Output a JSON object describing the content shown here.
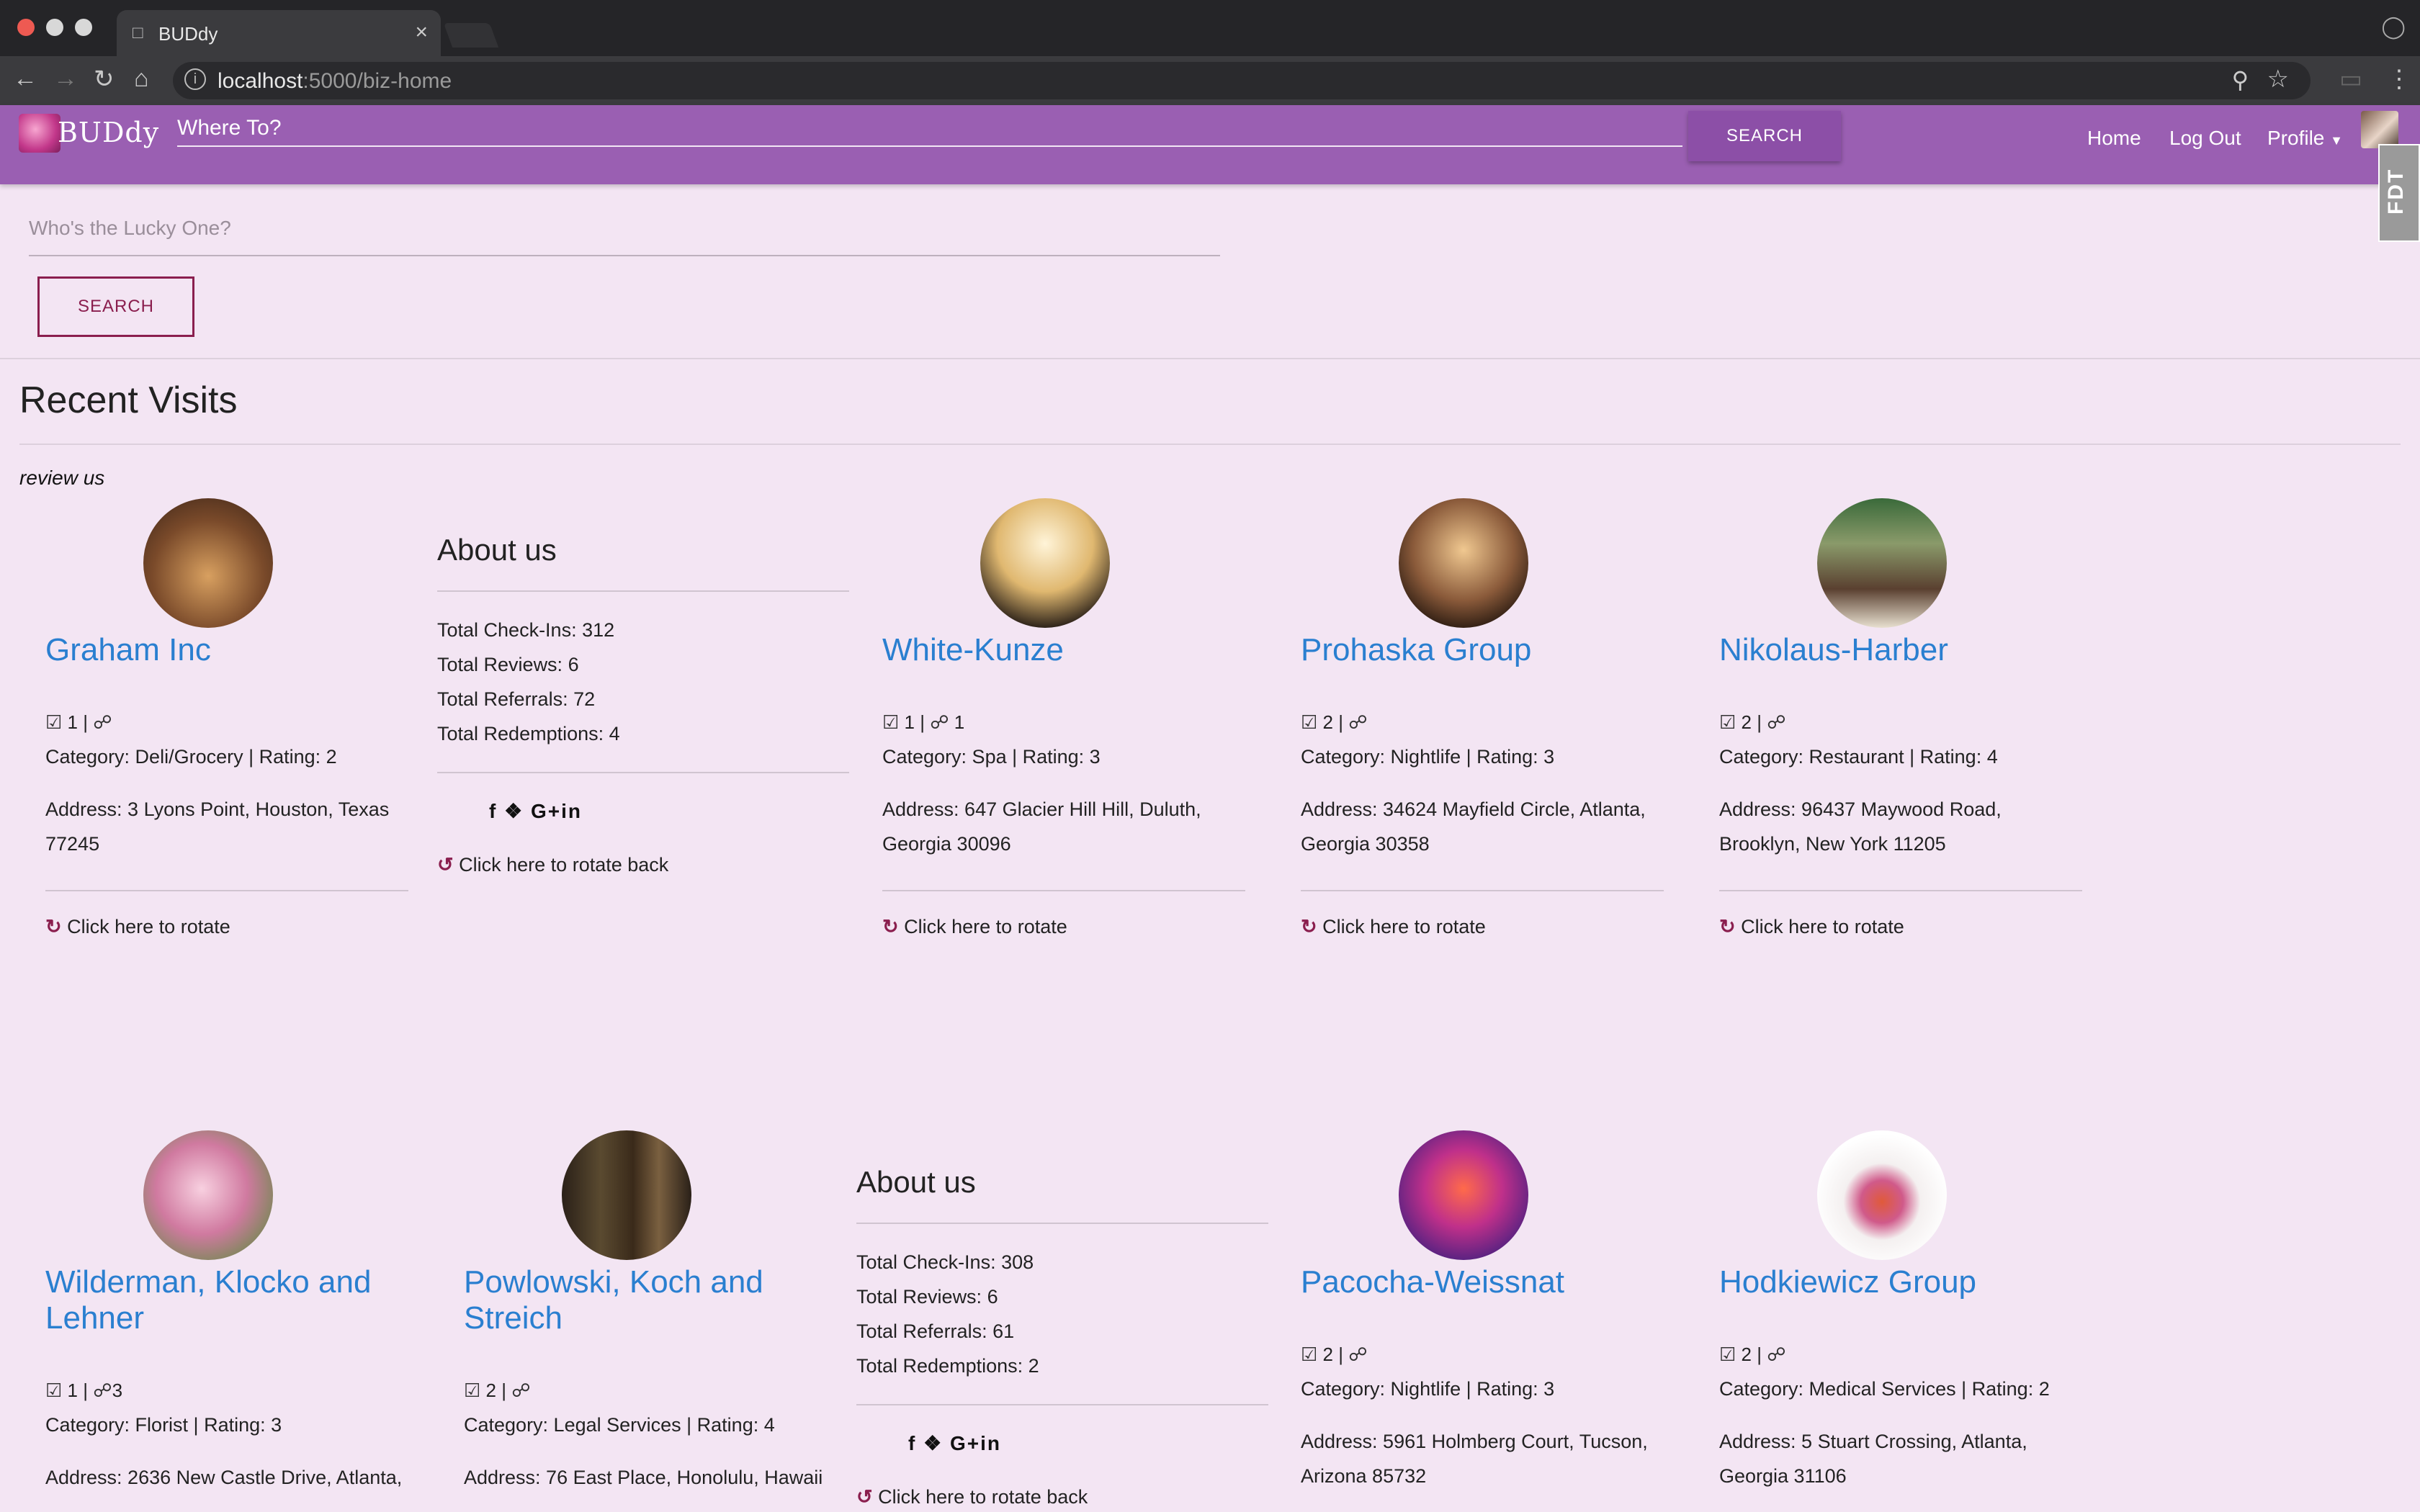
{
  "browser": {
    "tab_title": "BUDdy",
    "url_host": "localhost",
    "url_path": ":5000/biz-home"
  },
  "nav": {
    "logo_text": "BUDdy",
    "where_placeholder": "Where To?",
    "search_label": "SEARCH",
    "home": "Home",
    "logout": "Log Out",
    "profile": "Profile",
    "feedback": "FDT"
  },
  "search": {
    "placeholder": "Who's the Lucky One?",
    "button": "SEARCH"
  },
  "recent": {
    "title": "Recent Visits",
    "review_us": "review us"
  },
  "rotate_label": "Click here to rotate",
  "rotate_back_label": "Click here to rotate back",
  "social_label": "f  G+in",
  "cards": [
    {
      "name": "Graham Inc",
      "checkins": "1",
      "referrals": "",
      "category": "Category: Deli/Grocery | Rating: 2",
      "address": "Address: 3 Lyons Point, Houston, Texas 77245",
      "photo_color": "#7a4a2a"
    },
    {
      "name": "White-Kunze",
      "checkins": "1",
      "referrals": "1",
      "category": "Category: Spa | Rating: 3",
      "address": "Address: 647 Glacier Hill Hill, Duluth, Georgia 30096",
      "photo_color": "#c8a070"
    },
    {
      "name": "Prohaska Group",
      "checkins": "2",
      "referrals": "",
      "category": "Category: Nightlife | Rating: 3",
      "address": "Address: 34624 Mayfield Circle, Atlanta, Georgia 30358",
      "photo_color": "#8a5a3a"
    },
    {
      "name": "Nikolaus-Harber",
      "checkins": "2",
      "referrals": "",
      "category": "Category: Restaurant | Rating: 4",
      "address": "Address: 96437 Maywood Road, Brooklyn, New York 11205",
      "photo_color": "#5a6a4a"
    },
    {
      "name": "Wilderman, Klocko and Lehner",
      "checkins": "1",
      "referrals": "3",
      "category": "Category: Florist | Rating: 3",
      "address": "Address: 2636 New Castle Drive, Atlanta,",
      "photo_color": "#d07aa0"
    },
    {
      "name": "Powlowski, Koch and Streich",
      "checkins": "2",
      "referrals": "",
      "category": "Category: Legal Services | Rating: 4",
      "address": "Address: 76 East Place, Honolulu, Hawaii",
      "photo_color": "#4a3a2a"
    },
    {
      "name": "Pacocha-Weissnat",
      "checkins": "2",
      "referrals": "",
      "category": "Category: Nightlife | Rating: 3",
      "address": "Address: 5961 Holmberg Court, Tucson, Arizona 85732",
      "photo_color": "#a0307a"
    },
    {
      "name": "Hodkiewicz Group",
      "checkins": "2",
      "referrals": "",
      "category": "Category: Medical Services | Rating: 2",
      "address": "Address: 5 Stuart Crossing, Atlanta, Georgia 31106",
      "photo_color": "#e8e0e0"
    }
  ],
  "about_panels": [
    {
      "title": "About us",
      "checkins": "Total Check-Ins: 312",
      "reviews": "Total Reviews: 6",
      "referrals": "Total Referrals: 72",
      "redemptions": "Total Redemptions: 4"
    },
    {
      "title": "About us",
      "checkins": "Total Check-Ins: 308",
      "reviews": "Total Reviews: 6",
      "referrals": "Total Referrals: 61",
      "redemptions": "Total Redemptions: 2"
    }
  ]
}
